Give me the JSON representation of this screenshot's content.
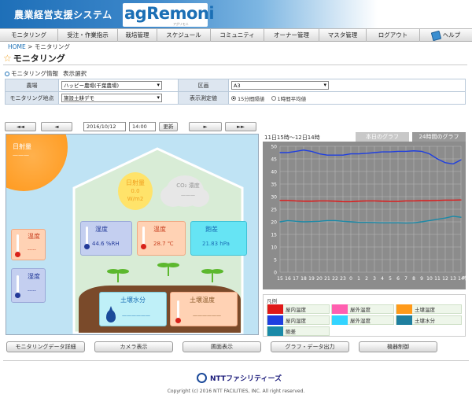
{
  "header": {
    "system_title": "農業経営支援システム",
    "logo_text": "agRemoni",
    "logo_sub": "アグリモニ"
  },
  "nav": {
    "items": [
      "モニタリング",
      "受注・作業指示",
      "栽培管理",
      "スケジュール",
      "コミュニティ",
      "オーナー管理",
      "マスタ管理",
      "ログアウト"
    ],
    "help": "ヘルプ"
  },
  "breadcrumb": {
    "home": "HOME",
    "sep": ">",
    "current": "モニタリング"
  },
  "page_title": "モニタリング",
  "section": {
    "info": "モニタリング情報",
    "display": "表示選択"
  },
  "conditions": {
    "farm_label": "農場",
    "farm_value": "ハッピー農場(千葉農場)",
    "zone_label": "区画",
    "zone_value": "A3",
    "point_label": "モニタリング地点",
    "point_value": "施設土耕デモ",
    "interval_label": "表示測定値",
    "interval_opt1": "15分間隔値",
    "interval_opt2": "1時間平均値"
  },
  "toolbar": {
    "prev_far": "◄◄",
    "prev": "◄",
    "date": "2016/10/12",
    "time": "14:00",
    "update": "更新",
    "next": "►",
    "next_far": "►►"
  },
  "scene": {
    "solar_out_label": "日射量",
    "solar_out_value": "———",
    "solar_in_label": "日射量",
    "solar_in_value": "0.0",
    "solar_in_unit": "W/m2",
    "co2_label": "CO₂ 濃度",
    "co2_value": "———",
    "humidity_in_label": "湿度",
    "humidity_in_value": "44.6 %RH",
    "temp_in_label": "温度",
    "temp_in_value": "28.7 ℃",
    "sat_label": "飽差",
    "sat_value": "21.83 hPa",
    "temp_out_label": "温度",
    "temp_out_value": "-----",
    "humidity_out_label": "湿度",
    "humidity_out_value": "-----",
    "soil_moist_label": "土壌水分",
    "soil_moist_value": "——————",
    "soil_temp_label": "土壌温度",
    "soil_temp_value": "——————"
  },
  "graph": {
    "range_label": "11日15時～12日14時",
    "tab_today": "本日のグラフ",
    "tab_24h": "24時間のグラフ",
    "x_unit": "時"
  },
  "chart_data": {
    "type": "line",
    "x": [
      "15",
      "16",
      "17",
      "18",
      "19",
      "20",
      "21",
      "22",
      "23",
      "0",
      "1",
      "2",
      "3",
      "4",
      "5",
      "6",
      "7",
      "8",
      "9",
      "10",
      "11",
      "12",
      "13",
      "14"
    ],
    "ylim": [
      0,
      50
    ],
    "yticks": [
      0,
      5,
      10,
      15,
      20,
      25,
      30,
      35,
      40,
      45,
      50
    ],
    "series": [
      {
        "name": "屋内湿度",
        "color": "#1f3fe0",
        "values": [
          47.5,
          47.5,
          48,
          48.5,
          48,
          47,
          46.5,
          46.5,
          46.5,
          47,
          47,
          47.2,
          47.5,
          47.8,
          47.8,
          48,
          48,
          48.2,
          48,
          47,
          45,
          43.5,
          43,
          44.6
        ]
      },
      {
        "name": "屋内温度",
        "color": "#e01818",
        "values": [
          28.5,
          28.5,
          28.3,
          28.2,
          28.2,
          28.3,
          28.3,
          28.2,
          28,
          28,
          28.2,
          28.3,
          28.3,
          28.2,
          28.1,
          28.1,
          28.3,
          28.3,
          28.4,
          28.4,
          28.5,
          28.6,
          28.6,
          28.7
        ]
      },
      {
        "name": "飽差",
        "color": "#1a8aa8",
        "values": [
          20,
          20.5,
          20.2,
          20,
          20.1,
          20.2,
          20.5,
          20.5,
          20.2,
          20,
          19.8,
          19.8,
          19.7,
          19.6,
          19.6,
          19.6,
          19.5,
          19.6,
          20,
          20.5,
          21,
          21.5,
          22.2,
          21.83
        ]
      }
    ]
  },
  "legend": {
    "title": "凡例",
    "items": [
      {
        "label": "屋内温度",
        "color": "#e01818"
      },
      {
        "label": "屋外温度",
        "color": "#ff5fb0"
      },
      {
        "label": "土壌温度",
        "color": "#ff9a1a"
      },
      {
        "label": "屋内湿度",
        "color": "#1f3fe0"
      },
      {
        "label": "屋外湿度",
        "color": "#33d4ff"
      },
      {
        "label": "土壌水分",
        "color": "#1f7f9f"
      },
      {
        "label": "飽差",
        "color": "#1a8aa8"
      }
    ]
  },
  "buttons": [
    "モニタリングデータ詳細",
    "カメラ表示",
    "圃面表示",
    "グラフ・データ出力",
    "機器制御"
  ],
  "footer": {
    "company": "NTTファシリティーズ",
    "copyright": "Copyright (c) 2016 NTT FACILITIES, INC. All right reserved."
  }
}
